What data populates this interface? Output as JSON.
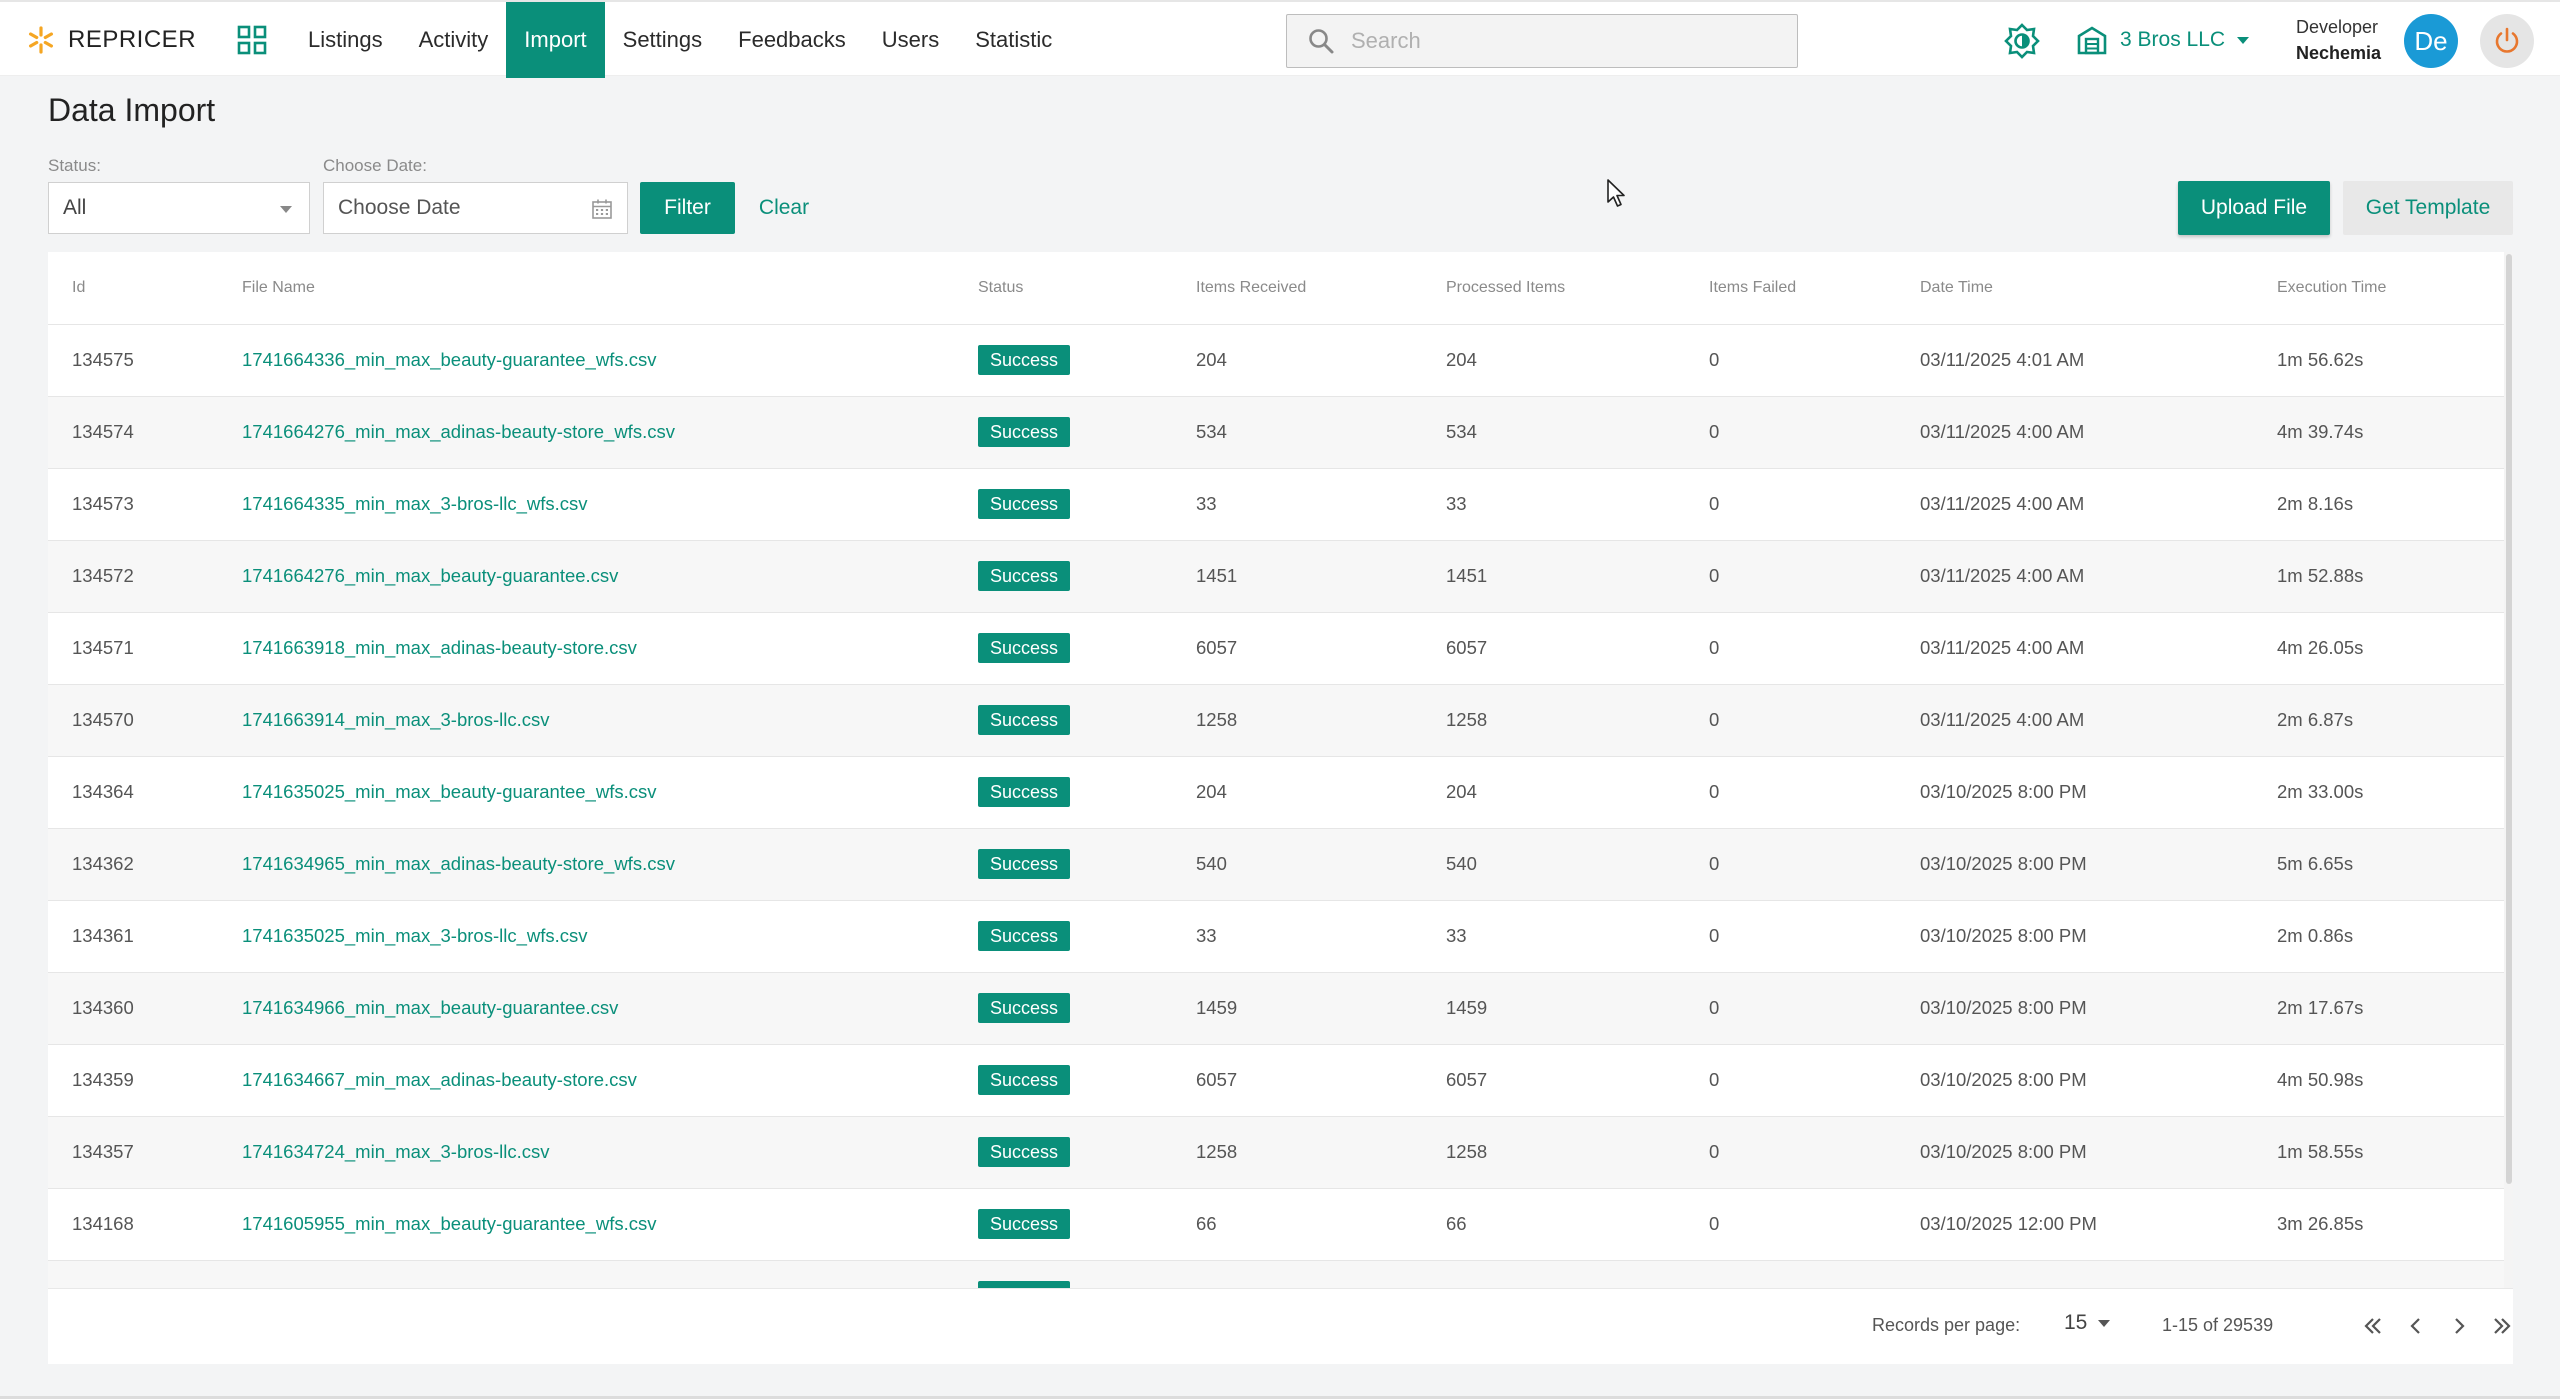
{
  "brand": {
    "name": "REPRICER",
    "accent": "#0a8f7a",
    "logo_color": "#f5a623"
  },
  "nav": [
    {
      "label": "Listings",
      "active": false
    },
    {
      "label": "Activity",
      "active": false
    },
    {
      "label": "Import",
      "active": true
    },
    {
      "label": "Settings",
      "active": false
    },
    {
      "label": "Feedbacks",
      "active": false
    },
    {
      "label": "Users",
      "active": false
    },
    {
      "label": "Statistic",
      "active": false
    }
  ],
  "search": {
    "placeholder": "Search",
    "value": ""
  },
  "company": {
    "name": "3 Bros LLC"
  },
  "user": {
    "role": "Developer",
    "name": "Nechemia",
    "initials": "De",
    "avatar_color": "#1a9ad6"
  },
  "page": {
    "title": "Data Import"
  },
  "filters": {
    "status_label": "Status:",
    "status_value": "All",
    "date_label": "Choose Date:",
    "date_placeholder": "Choose Date",
    "filter_button": "Filter",
    "clear_button": "Clear"
  },
  "actions": {
    "upload_label": "Upload File",
    "template_label": "Get Template"
  },
  "table": {
    "columns": [
      "Id",
      "File Name",
      "Status",
      "Items Received",
      "Processed Items",
      "Items Failed",
      "Date Time",
      "Execution Time"
    ],
    "rows": [
      {
        "id": "134575",
        "file": "1741664336_min_max_beauty-guarantee_wfs.csv",
        "status": "Success",
        "received": "204",
        "processed": "204",
        "failed": "0",
        "datetime": "03/11/2025 4:01 AM",
        "exec": "1m 56.62s"
      },
      {
        "id": "134574",
        "file": "1741664276_min_max_adinas-beauty-store_wfs.csv",
        "status": "Success",
        "received": "534",
        "processed": "534",
        "failed": "0",
        "datetime": "03/11/2025 4:00 AM",
        "exec": "4m 39.74s"
      },
      {
        "id": "134573",
        "file": "1741664335_min_max_3-bros-llc_wfs.csv",
        "status": "Success",
        "received": "33",
        "processed": "33",
        "failed": "0",
        "datetime": "03/11/2025 4:00 AM",
        "exec": "2m 8.16s"
      },
      {
        "id": "134572",
        "file": "1741664276_min_max_beauty-guarantee.csv",
        "status": "Success",
        "received": "1451",
        "processed": "1451",
        "failed": "0",
        "datetime": "03/11/2025 4:00 AM",
        "exec": "1m 52.88s"
      },
      {
        "id": "134571",
        "file": "1741663918_min_max_adinas-beauty-store.csv",
        "status": "Success",
        "received": "6057",
        "processed": "6057",
        "failed": "0",
        "datetime": "03/11/2025 4:00 AM",
        "exec": "4m 26.05s"
      },
      {
        "id": "134570",
        "file": "1741663914_min_max_3-bros-llc.csv",
        "status": "Success",
        "received": "1258",
        "processed": "1258",
        "failed": "0",
        "datetime": "03/11/2025 4:00 AM",
        "exec": "2m 6.87s"
      },
      {
        "id": "134364",
        "file": "1741635025_min_max_beauty-guarantee_wfs.csv",
        "status": "Success",
        "received": "204",
        "processed": "204",
        "failed": "0",
        "datetime": "03/10/2025 8:00 PM",
        "exec": "2m 33.00s"
      },
      {
        "id": "134362",
        "file": "1741634965_min_max_adinas-beauty-store_wfs.csv",
        "status": "Success",
        "received": "540",
        "processed": "540",
        "failed": "0",
        "datetime": "03/10/2025 8:00 PM",
        "exec": "5m 6.65s"
      },
      {
        "id": "134361",
        "file": "1741635025_min_max_3-bros-llc_wfs.csv",
        "status": "Success",
        "received": "33",
        "processed": "33",
        "failed": "0",
        "datetime": "03/10/2025 8:00 PM",
        "exec": "2m 0.86s"
      },
      {
        "id": "134360",
        "file": "1741634966_min_max_beauty-guarantee.csv",
        "status": "Success",
        "received": "1459",
        "processed": "1459",
        "failed": "0",
        "datetime": "03/10/2025 8:00 PM",
        "exec": "2m 17.67s"
      },
      {
        "id": "134359",
        "file": "1741634667_min_max_adinas-beauty-store.csv",
        "status": "Success",
        "received": "6057",
        "processed": "6057",
        "failed": "0",
        "datetime": "03/10/2025 8:00 PM",
        "exec": "4m 50.98s"
      },
      {
        "id": "134357",
        "file": "1741634724_min_max_3-bros-llc.csv",
        "status": "Success",
        "received": "1258",
        "processed": "1258",
        "failed": "0",
        "datetime": "03/10/2025 8:00 PM",
        "exec": "1m 58.55s"
      },
      {
        "id": "134168",
        "file": "1741605955_min_max_beauty-guarantee_wfs.csv",
        "status": "Success",
        "received": "66",
        "processed": "66",
        "failed": "0",
        "datetime": "03/10/2025 12:00 PM",
        "exec": "3m 26.85s"
      },
      {
        "id": "",
        "file": "",
        "status": "Success",
        "received": "",
        "processed": "",
        "failed": "",
        "datetime": "",
        "exec": ""
      }
    ]
  },
  "pagination": {
    "records_label": "Records per page:",
    "per_page": "15",
    "range": "1-15 of 29539"
  },
  "icons": {
    "brand": "spark-logo-icon",
    "apps": "apps-grid-icon",
    "search": "search-icon",
    "theme": "brightness-icon",
    "company": "store-icon",
    "power": "power-icon",
    "calendar": "calendar-icon"
  }
}
